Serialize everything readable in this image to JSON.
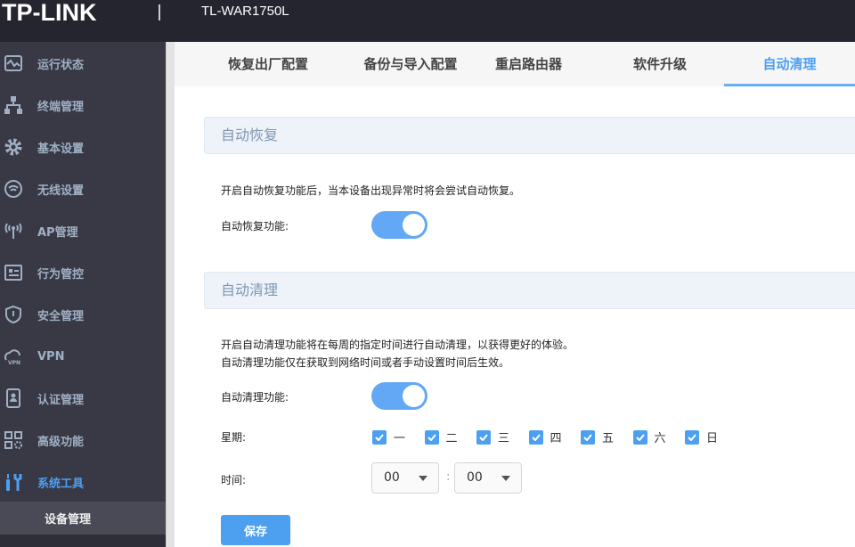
{
  "header": {
    "logo": "TP-LINK",
    "model": "TL-WAR1750L"
  },
  "sidebar": {
    "items": [
      {
        "label": "运行状态",
        "icon": "monitor-chart-icon"
      },
      {
        "label": "终端管理",
        "icon": "network-tree-icon"
      },
      {
        "label": "基本设置",
        "icon": "gear-icon"
      },
      {
        "label": "无线设置",
        "icon": "wifi-icon"
      },
      {
        "label": "AP管理",
        "icon": "antenna-icon"
      },
      {
        "label": "行为管控",
        "icon": "behavior-control-icon"
      },
      {
        "label": "安全管理",
        "icon": "shield-icon"
      },
      {
        "label": "VPN",
        "icon": "vpn-cloud-icon"
      },
      {
        "label": "认证管理",
        "icon": "id-badge-icon"
      },
      {
        "label": "高级功能",
        "icon": "grid-gear-icon"
      },
      {
        "label": "系统工具",
        "icon": "tools-icon",
        "active": true
      }
    ],
    "sub_item": "设备管理"
  },
  "tabs": [
    {
      "label": "恢复出厂配置"
    },
    {
      "label": "备份与导入配置"
    },
    {
      "label": "重启路由器"
    },
    {
      "label": "软件升级"
    },
    {
      "label": "自动清理",
      "active": true
    }
  ],
  "auto_recover": {
    "title": "自动恢复",
    "desc": "开启自动恢复功能后，当本设备出现异常时将会尝试自动恢复。",
    "label": "自动恢复功能:",
    "enabled": true
  },
  "auto_clean": {
    "title": "自动清理",
    "desc1": "开启自动清理功能将在每周的指定时间进行自动清理，以获得更好的体验。",
    "desc2": "自动清理功能仅在获取到网络时间或者手动设置时间后生效。",
    "label": "自动清理功能:",
    "enabled": true,
    "week_label": "星期:",
    "days": [
      {
        "label": "一",
        "checked": true
      },
      {
        "label": "二",
        "checked": true
      },
      {
        "label": "三",
        "checked": true
      },
      {
        "label": "四",
        "checked": true
      },
      {
        "label": "五",
        "checked": true
      },
      {
        "label": "六",
        "checked": true
      },
      {
        "label": "日",
        "checked": true
      }
    ],
    "time_label": "时间:",
    "hour": "00",
    "minute": "00",
    "separator": ":"
  },
  "save_label": "保存",
  "colors": {
    "accent": "#4d9ff0",
    "header_bg": "#25252f",
    "sidebar_bg": "#393945"
  }
}
